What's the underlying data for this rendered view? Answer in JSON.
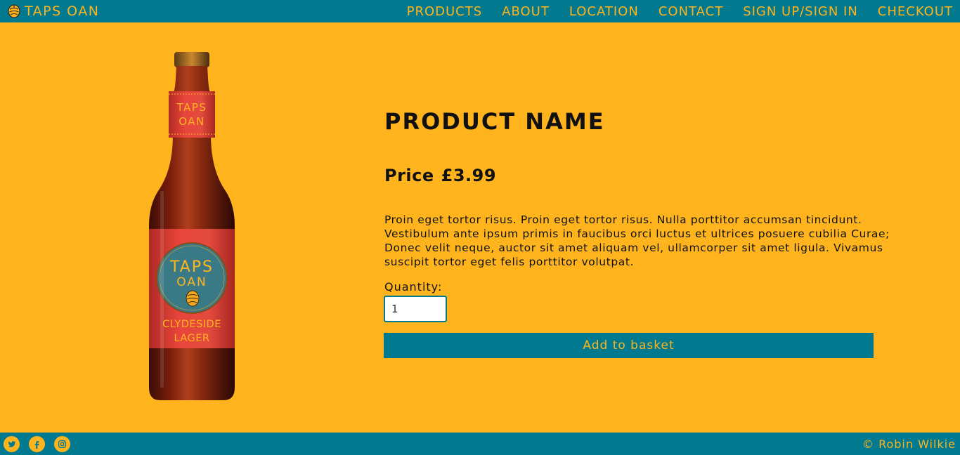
{
  "header": {
    "brand_name": "TAPS OAN",
    "nav": [
      {
        "label": "PRODUCTS"
      },
      {
        "label": "ABOUT"
      },
      {
        "label": "LOCATION"
      },
      {
        "label": "CONTACT"
      },
      {
        "label": "SIGN UP/SIGN IN"
      },
      {
        "label": "CHECKOUT"
      }
    ]
  },
  "product": {
    "image_label": {
      "neck_line1": "TAPS",
      "neck_line2": "OAN",
      "badge_line1": "TAPS",
      "badge_line2": "OAN",
      "variety_line1": "CLYDESIDE",
      "variety_line2": "LAGER"
    },
    "name": "PRODUCT NAME",
    "price_label": "Price",
    "price_value": "£3.99",
    "description": "Proin eget tortor risus. Proin eget tortor risus. Nulla porttitor accumsan tincidunt. Vestibulum ante ipsum primis in faucibus orci luctus et ultrices posuere cubilia Curae; Donec velit neque, auctor sit amet aliquam vel, ullamcorper sit amet ligula. Vivamus suscipit tortor eget felis porttitor volutpat.",
    "quantity_label": "Quantity:",
    "quantity_value": "1",
    "add_button_label": "Add to basket"
  },
  "footer": {
    "socials": [
      {
        "icon": "twitter-icon"
      },
      {
        "icon": "facebook-icon"
      },
      {
        "icon": "instagram-icon"
      }
    ],
    "copyright": "© Robin Wilkie"
  },
  "colors": {
    "background": "#FFB41E",
    "bar": "#017A8F",
    "text": "#111111",
    "label_red": "#E8453C"
  }
}
